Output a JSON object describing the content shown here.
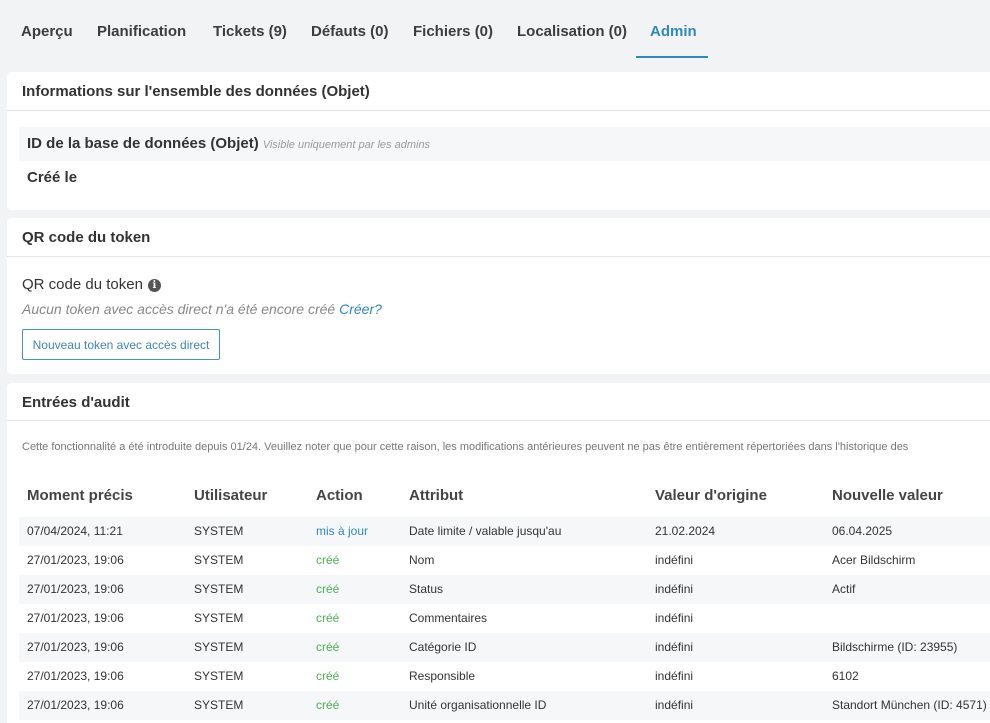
{
  "tabs": [
    {
      "label": "Aperçu",
      "active": false
    },
    {
      "label": "Planification",
      "active": false
    },
    {
      "label": "Tickets (9)",
      "active": false
    },
    {
      "label": "Défauts (0)",
      "active": false
    },
    {
      "label": "Fichiers (0)",
      "active": false
    },
    {
      "label": "Localisation (0)",
      "active": false
    },
    {
      "label": "Admin",
      "active": true
    }
  ],
  "dataset_info": {
    "title": "Informations sur l'ensemble des données (Objet)",
    "db_id_label": "ID de la base de données (Objet)",
    "db_id_hint": "Visible uniquement par les admins",
    "created_label": "Créé le"
  },
  "qr": {
    "title": "QR code du token",
    "label": "QR code du token",
    "info_icon": "info-icon",
    "empty_text": "Aucun token avec accès direct n'a été encore créé",
    "create_link": "Créer?",
    "button_label": "Nouveau token avec accès direct"
  },
  "audit": {
    "title": "Entrées d'audit",
    "note": "Cette fonctionnalité a été introduite depuis 01/24. Veuillez noter que pour cette raison, les modifications antérieures peuvent ne pas être entièrement répertoriées dans l'historique des",
    "headers": [
      "Moment précis",
      "Utilisateur",
      "Action",
      "Attribut",
      "Valeur d'origine",
      "Nouvelle valeur"
    ],
    "rows": [
      {
        "time": "07/04/2024, 11:21",
        "user": "SYSTEM",
        "action": "mis à jour",
        "action_type": "update",
        "attribute": "Date limite / valable jusqu'au",
        "old": "21.02.2024",
        "new": "06.04.2025"
      },
      {
        "time": "27/01/2023, 19:06",
        "user": "SYSTEM",
        "action": "créé",
        "action_type": "create",
        "attribute": "Nom",
        "old": "indéfini",
        "new": "Acer Bildschirm"
      },
      {
        "time": "27/01/2023, 19:06",
        "user": "SYSTEM",
        "action": "créé",
        "action_type": "create",
        "attribute": "Status",
        "old": "indéfini",
        "new": "Actif"
      },
      {
        "time": "27/01/2023, 19:06",
        "user": "SYSTEM",
        "action": "créé",
        "action_type": "create",
        "attribute": "Commentaires",
        "old": "indéfini",
        "new": ""
      },
      {
        "time": "27/01/2023, 19:06",
        "user": "SYSTEM",
        "action": "créé",
        "action_type": "create",
        "attribute": "Catégorie ID",
        "old": "indéfini",
        "new": "Bildschirme (ID: 23955)"
      },
      {
        "time": "27/01/2023, 19:06",
        "user": "SYSTEM",
        "action": "créé",
        "action_type": "create",
        "attribute": "Responsible",
        "old": "indéfini",
        "new": "6102"
      },
      {
        "time": "27/01/2023, 19:06",
        "user": "SYSTEM",
        "action": "créé",
        "action_type": "create",
        "attribute": "Unité organisationnelle ID",
        "old": "indéfini",
        "new": "Standort München (ID: 4571)"
      }
    ]
  },
  "colors": {
    "accent": "#2f89b9",
    "created": "#4caf50",
    "background": "#f2f3f5"
  }
}
